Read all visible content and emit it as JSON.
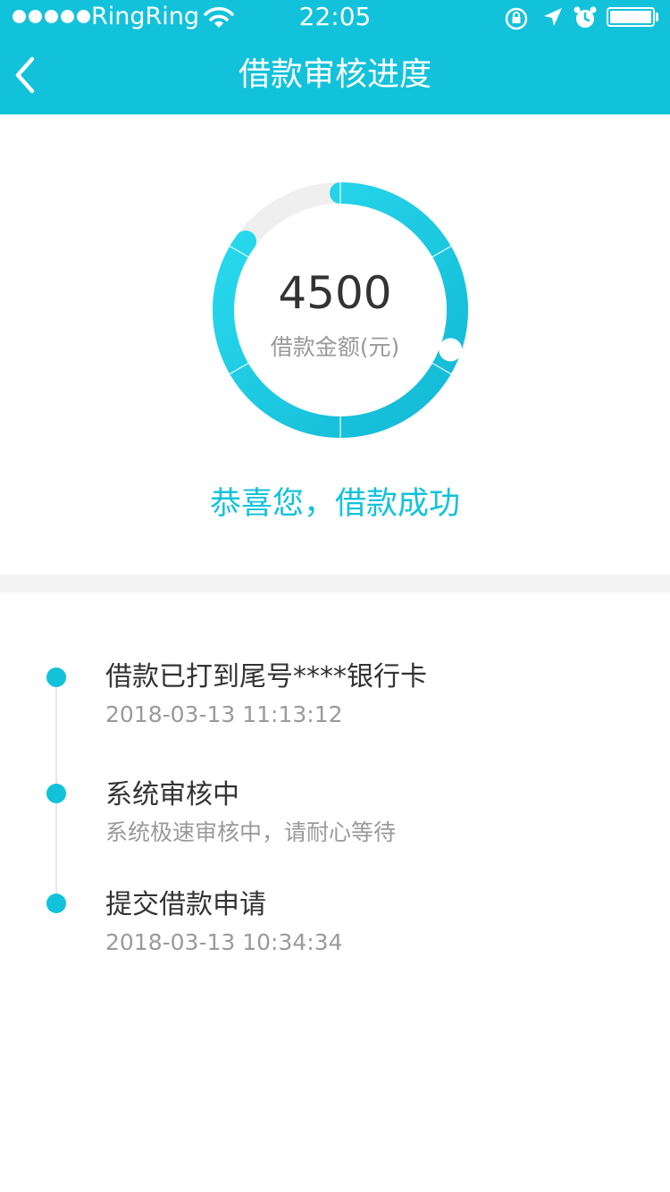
{
  "status_bar": {
    "carrier": "RingRing",
    "time": "22:05"
  },
  "nav": {
    "title": "借款审核进度",
    "back_icon": "chevron-left-icon"
  },
  "loan": {
    "amount": "4500",
    "amount_label": "借款金额(元)",
    "progress_fraction": 0.85,
    "message": "恭喜您，借款成功"
  },
  "timeline": [
    {
      "title": "借款已打到尾号****银行卡",
      "subtitle": "2018-03-13  11:13:12"
    },
    {
      "title": "系统审核中",
      "subtitle": "系统极速审核中，请耐心等待"
    },
    {
      "title": "提交借款申请",
      "subtitle": "2018-03-13  10:34:34"
    }
  ],
  "colors": {
    "accent": "#12C2DA",
    "ring_start": "#2ADCF0",
    "ring_end": "#12B8D4",
    "track": "#EFEFEF"
  }
}
